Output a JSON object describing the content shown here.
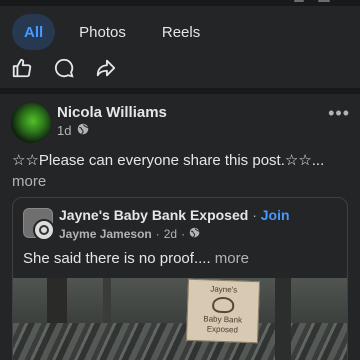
{
  "tabs": [
    {
      "label": "All",
      "active": true
    },
    {
      "label": "Photos",
      "active": false
    },
    {
      "label": "Reels",
      "active": false
    }
  ],
  "actions": [
    {
      "icon": "like-icon"
    },
    {
      "icon": "comment-icon"
    },
    {
      "icon": "share-icon"
    }
  ],
  "post": {
    "author": "Nicola Williams",
    "time": "1d",
    "privacy_icon": "globe-icon",
    "menu_icon": "more-options-icon",
    "text": "☆☆Please can everyone share this post.☆☆...",
    "see_more": "more"
  },
  "shared_post": {
    "group": "Jayne's Baby Bank Exposed",
    "separator": "·",
    "join_label": "Join",
    "poster": "Jayme Jameson",
    "time": "2d",
    "privacy_icon": "globe-icon",
    "text": "She said there is no proof....",
    "see_more": "more",
    "image": {
      "sign_line1": "Jayne's",
      "sign_line2": "Baby Bank Exposed"
    }
  },
  "colors": {
    "background": "#242526",
    "accent": "#4599ff",
    "active_tab_bg": "#263951",
    "text_primary": "#e4e6eb",
    "text_secondary": "#b0b3b8"
  }
}
